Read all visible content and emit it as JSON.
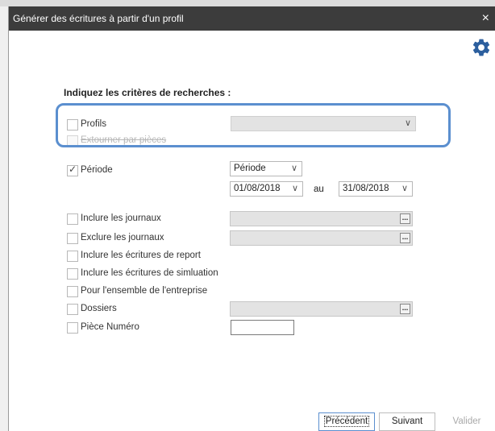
{
  "window": {
    "title": "Générer des écritures à partir d'un profil",
    "close_symbol": "×"
  },
  "toolbar": {
    "settings_icon": "gear-icon"
  },
  "form": {
    "heading": "Indiquez les critères de recherches :",
    "profils": {
      "label": "Profils",
      "checked": false,
      "selected": ""
    },
    "extourner": {
      "label": "Extourner par pièces",
      "checked": false,
      "disabled": true
    },
    "periode": {
      "label": "Période",
      "checked": true,
      "mode": "Période",
      "from": "01/08/2018",
      "between_label": "au",
      "to": "31/08/2018"
    },
    "inclure_journaux": {
      "label": "Inclure les journaux",
      "checked": false,
      "value": ""
    },
    "exclure_journaux": {
      "label": "Exclure les journaux",
      "checked": false,
      "value": ""
    },
    "inclure_report": {
      "label": "Inclure les écritures de report",
      "checked": false
    },
    "inclure_simulation": {
      "label": "Inclure les écritures de simluation",
      "checked": false
    },
    "ensemble_entreprise": {
      "label": "Pour l'ensemble de l'entreprise",
      "checked": false
    },
    "dossiers": {
      "label": "Dossiers",
      "checked": false,
      "value": ""
    },
    "piece_numero": {
      "label": "Pièce Numéro",
      "checked": false,
      "value": ""
    },
    "ellipsis": "...",
    "dropdown_arrow": "∨",
    "check_mark": "✓"
  },
  "buttons": {
    "previous": "Précédent",
    "next": "Suivant",
    "validate": "Valider"
  },
  "colors": {
    "titlebar": "#3c3c3c",
    "accent": "#5b8fcf",
    "gear": "#2c5f9e"
  }
}
